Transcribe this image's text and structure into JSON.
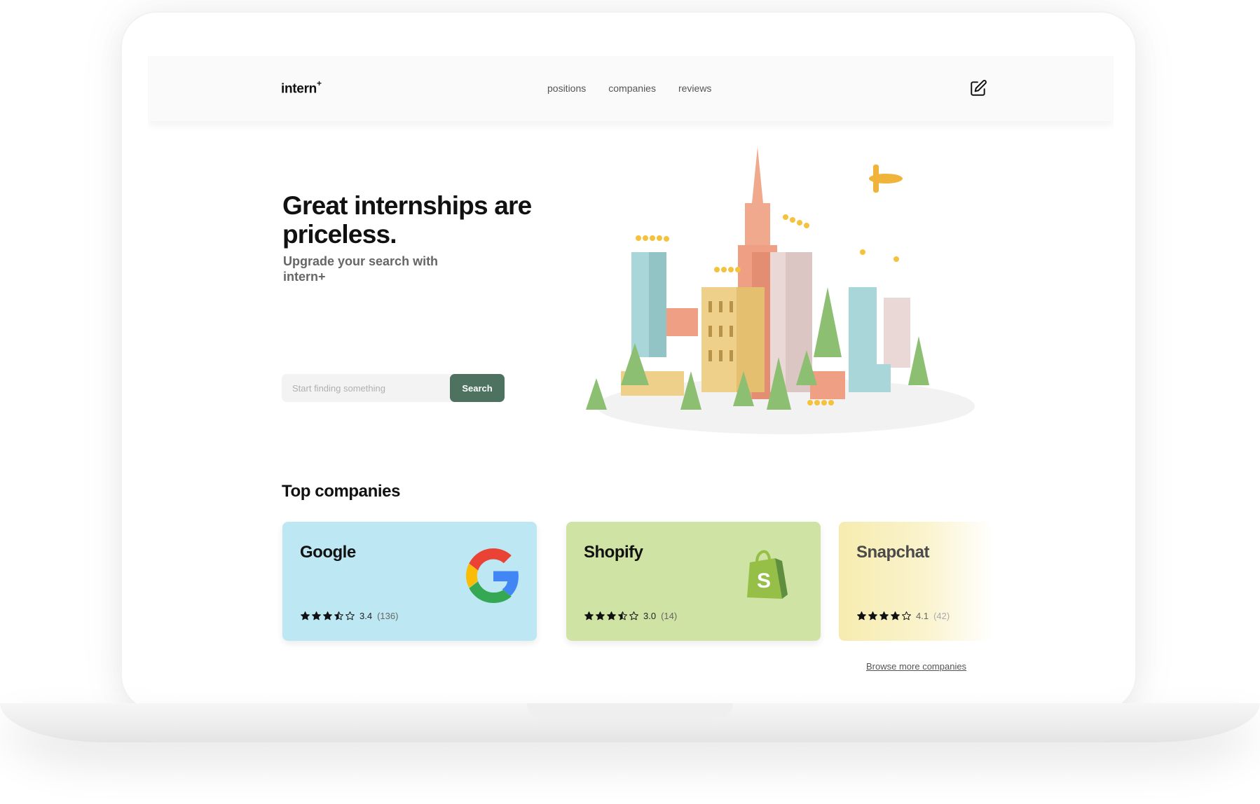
{
  "brand": {
    "name": "intern",
    "superscript": "+"
  },
  "nav": {
    "items": [
      {
        "label": "positions"
      },
      {
        "label": "companies"
      },
      {
        "label": "reviews"
      }
    ]
  },
  "hero": {
    "title": "Great internships are priceless.",
    "subtitle": "Upgrade your search with intern+",
    "search": {
      "placeholder": "Start finding something",
      "value": "",
      "button_label": "Search"
    }
  },
  "top_companies": {
    "title": "Top companies",
    "cards": [
      {
        "name": "Google",
        "rating": "3.4",
        "reviews": "(136)",
        "stars": 3.5,
        "color": "#bde8f3",
        "logo": "google-logo"
      },
      {
        "name": "Shopify",
        "rating": "3.0",
        "reviews": "(14)",
        "stars": 3.5,
        "color": "#cfe3a4",
        "logo": "shopify-logo"
      },
      {
        "name": "Snapchat",
        "rating": "4.1",
        "reviews": "(42)",
        "stars": 4,
        "color": "#f6ecb0",
        "logo": "snapchat-logo"
      }
    ],
    "browse_label": "Browse more companies"
  },
  "colors": {
    "accent": "#4d7260",
    "navbar": "#fafafa"
  },
  "icons": {
    "edit": "edit-icon",
    "star": "star-icon"
  }
}
